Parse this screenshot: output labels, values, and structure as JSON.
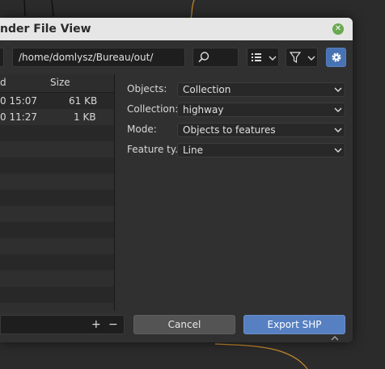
{
  "window": {
    "title": "nder File View"
  },
  "toolbar": {
    "path": "/home/domlysz/Bureau/out/",
    "search_icon": "search-icon",
    "display_mode_icon": "list-view-icon",
    "filter_icon": "funnel-icon",
    "settings_icon": "gear-icon"
  },
  "file_list": {
    "columns": [
      "d",
      "Size"
    ],
    "rows": [
      {
        "date": "0 15:07",
        "size": "61 KB"
      },
      {
        "date": "0 11:27",
        "size": "1 KB"
      }
    ]
  },
  "options": {
    "objects": {
      "label": "Objects:",
      "value": "Collection"
    },
    "collection": {
      "label": "Collection:",
      "value": "highway"
    },
    "mode": {
      "label": "Mode:",
      "value": "Objects to features"
    },
    "feature_type": {
      "label": "Feature ty..",
      "value": "Line"
    }
  },
  "footer": {
    "plus": "+",
    "minus": "−",
    "cancel_label": "Cancel",
    "export_label": "Export SHP"
  },
  "colors": {
    "accent": "#5680c2",
    "titlebar": "#e6e6e6",
    "panel": "#303030"
  }
}
